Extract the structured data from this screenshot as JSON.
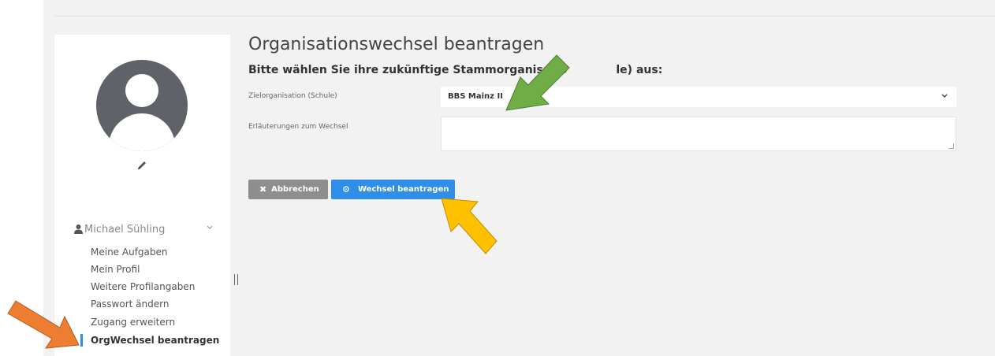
{
  "sidebar": {
    "user_name": "Michael Sühling",
    "items": [
      {
        "label": "Meine Aufgaben"
      },
      {
        "label": "Mein Profil"
      },
      {
        "label": "Weitere Profilangaben"
      },
      {
        "label": "Passwort ändern"
      },
      {
        "label": "Zugang erweitern"
      },
      {
        "label": "OrgWechsel beantragen",
        "active": true
      }
    ]
  },
  "main": {
    "title": "Organisationswechsel beantragen",
    "subtitle_before": "Bitte wählen Sie ihre zukünftige Stammorganisatio",
    "subtitle_after": "le) aus:",
    "fields": {
      "target_label": "Zielorganisation (Schule)",
      "target_value": "BBS Mainz II",
      "explanation_label": "Erläuterungen zum Wechsel",
      "explanation_value": ""
    },
    "buttons": {
      "cancel_icon": "✖",
      "cancel_label": "Abbrechen",
      "submit_icon": "⚙",
      "submit_label": "Wechsel beantragen"
    }
  },
  "icons": {
    "avatar": "user-avatar-icon",
    "edit": "pencil-icon",
    "user": "user-icon",
    "dropdown": "chevron-down-icon"
  },
  "colors": {
    "accent": "#2f8ee8",
    "cancel": "#8e8e8e",
    "avatar": "#5f6269",
    "arrow_green": "#70ad47",
    "arrow_yellow": "#ffc000",
    "arrow_orange": "#ed7d31"
  }
}
